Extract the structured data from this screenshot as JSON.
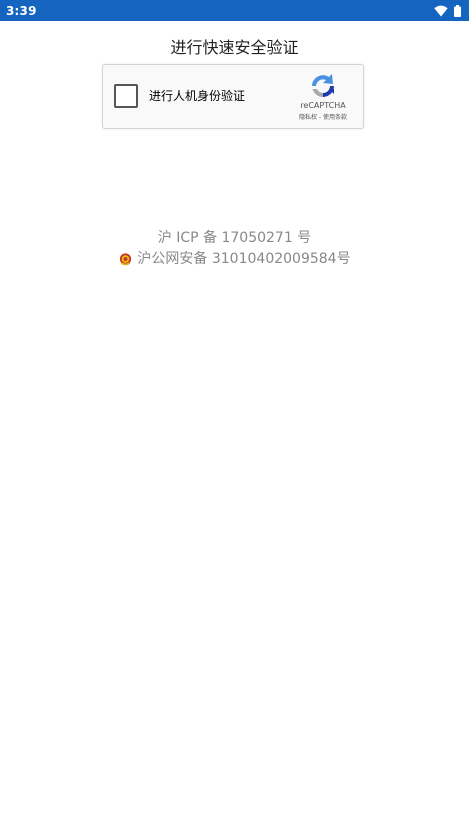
{
  "status_bar": {
    "time": "3:39",
    "icons": [
      "wifi-icon",
      "battery-icon"
    ],
    "color": "#1565c0"
  },
  "page": {
    "title": "进行快速安全验证"
  },
  "captcha": {
    "label": "进行人机身份验证",
    "brand": "reCAPTCHA",
    "privacy_link": "隐私权",
    "separator": " - ",
    "terms_link": "使用条款",
    "checked": false,
    "icon": "recaptcha-logo-icon"
  },
  "footer": {
    "icp": "沪 ICP 备 17050271 号",
    "police_record": "沪公网安备 31010402009584号",
    "police_icon": "police-badge-icon"
  }
}
